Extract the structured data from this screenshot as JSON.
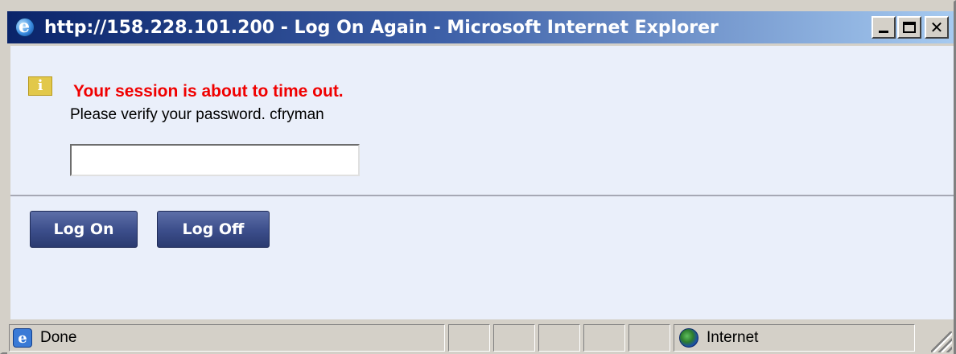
{
  "window": {
    "title": "http://158.228.101.200 - Log On Again - Microsoft Internet Explorer",
    "controls": {
      "minimize": "_",
      "maximize": "□",
      "close": "✕"
    }
  },
  "dialog": {
    "info_icon_glyph": "i",
    "warning_text": "Your session is about to time out.",
    "prompt_text": "Please verify your password. cfryman",
    "password_value": "",
    "log_on_label": "Log On",
    "log_off_label": "Log Off"
  },
  "statusbar": {
    "status_text": "Done",
    "zone_text": "Internet"
  },
  "colors": {
    "warning": "#f00000",
    "button_bg": "#3b4d8a",
    "content_bg": "#eaeffa"
  }
}
